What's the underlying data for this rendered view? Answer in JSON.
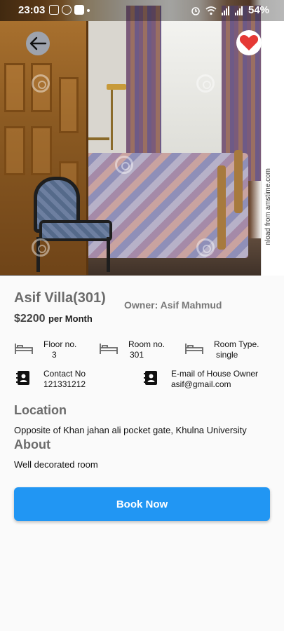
{
  "status_bar": {
    "time": "23:03",
    "battery": "54%"
  },
  "listing": {
    "title": "Asif Villa(301)",
    "owner": "Owner: Asif Mahmud",
    "price": "$2200",
    "price_unit": "per Month"
  },
  "specs": {
    "floor_label": "Floor no.",
    "floor_value": "3",
    "room_label": "Room no.",
    "room_value": "301",
    "type_label": "Room Type.",
    "type_value": "single"
  },
  "contact": {
    "phone_label": "Contact No",
    "phone_value": "121331212",
    "email_label": "E-mail of House Owner",
    "email_value": "asif@gmail.com"
  },
  "location": {
    "heading": "Location",
    "text": "Opposite of Khan jahan ali pocket gate, Khulna University"
  },
  "about": {
    "heading": "About",
    "text": "Well decorated room"
  },
  "actions": {
    "book_label": "Book Now"
  },
  "image_credit": "nload from  amstime.com",
  "colors": {
    "primary": "#2196f3",
    "favorite": "#e53935",
    "heading_gray": "#6b6b6b"
  },
  "icons": {
    "back": "arrow-left-icon",
    "favorite": "heart-icon",
    "floor": "bed-icon",
    "room": "bed-icon",
    "type": "bed-icon",
    "phone": "contact-book-icon",
    "email": "contact-book-icon"
  }
}
